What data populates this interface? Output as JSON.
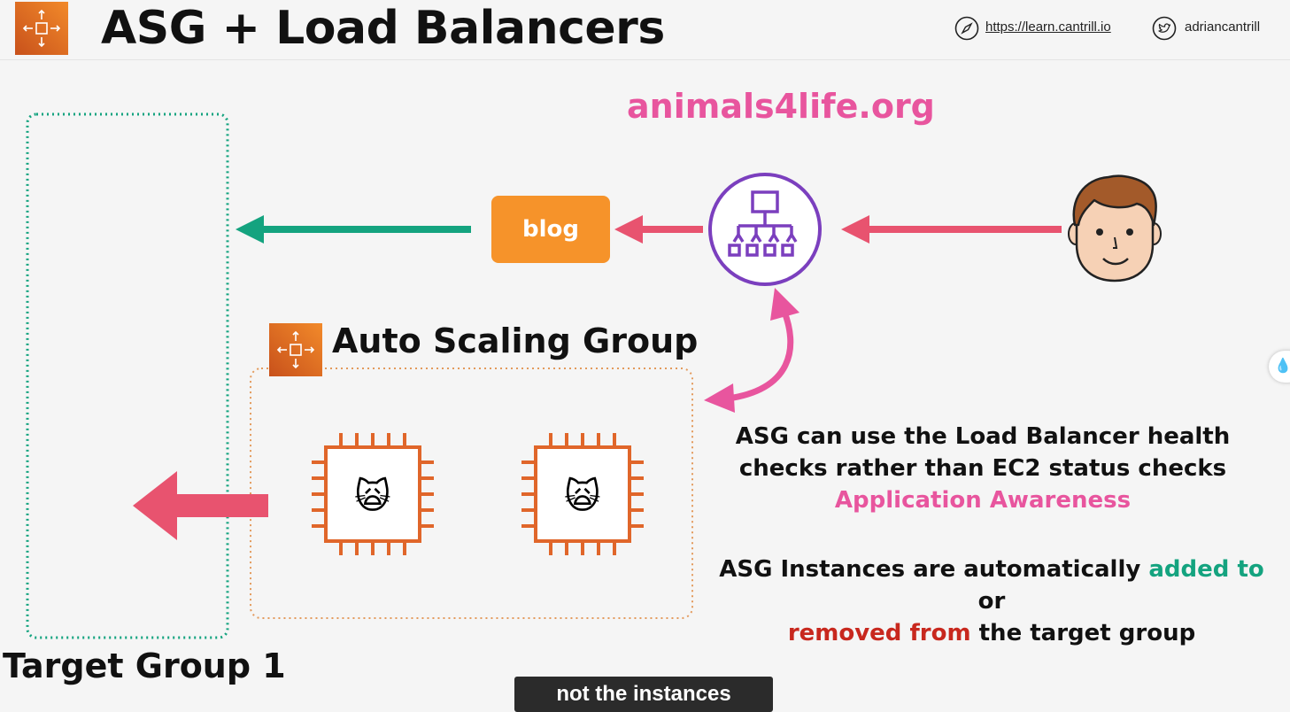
{
  "header": {
    "title": "ASG + Load Balancers",
    "link_url": "https://learn.cantrill.io",
    "twitter_handle": "adriancantrill"
  },
  "diagram": {
    "domain": "animals4life.org",
    "blog_label": "blog",
    "asg_label": "Auto Scaling Group",
    "target_group_label": "Target Group 1",
    "note1_line1": "ASG can use the Load Balancer health",
    "note1_line2": "checks rather than EC2 status checks",
    "note1_highlight": "Application Awareness",
    "note2_part1": "ASG Instances are automatically",
    "note2_added": "added to",
    "note2_or": "or",
    "note2_removed": "removed from",
    "note2_part2": "the target group",
    "instance_emoji": "🙀"
  },
  "caption": "not the instances",
  "colors": {
    "asg_orange": "#e8711e",
    "blog_orange": "#f6932a",
    "pink": "#e8559e",
    "red_arrow": "#e8536f",
    "green": "#14a37f",
    "elb_purple": "#7b3fbe",
    "target_group_dotted": "#14a37f",
    "asg_dotted": "#e8a060"
  },
  "icons": [
    "asg-icon",
    "compass-icon",
    "twitter-icon",
    "load-balancer-icon",
    "user-face-icon",
    "ec2-instance-icon"
  ]
}
